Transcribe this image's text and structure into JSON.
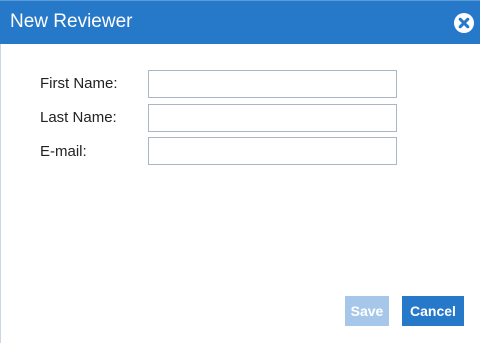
{
  "dialog": {
    "title": "New Reviewer",
    "close_icon": "close-circle-icon"
  },
  "form": {
    "fields": [
      {
        "label": "First Name:",
        "value": "",
        "placeholder": ""
      },
      {
        "label": "Last Name:",
        "value": "",
        "placeholder": ""
      },
      {
        "label": "E-mail:",
        "value": "",
        "placeholder": ""
      }
    ]
  },
  "buttons": {
    "save_label": "Save",
    "save_state": "disabled",
    "cancel_label": "Cancel"
  },
  "colors": {
    "titlebar": "#2678c9",
    "save_disabled": "#a7c7ea",
    "cancel": "#2678c9"
  }
}
